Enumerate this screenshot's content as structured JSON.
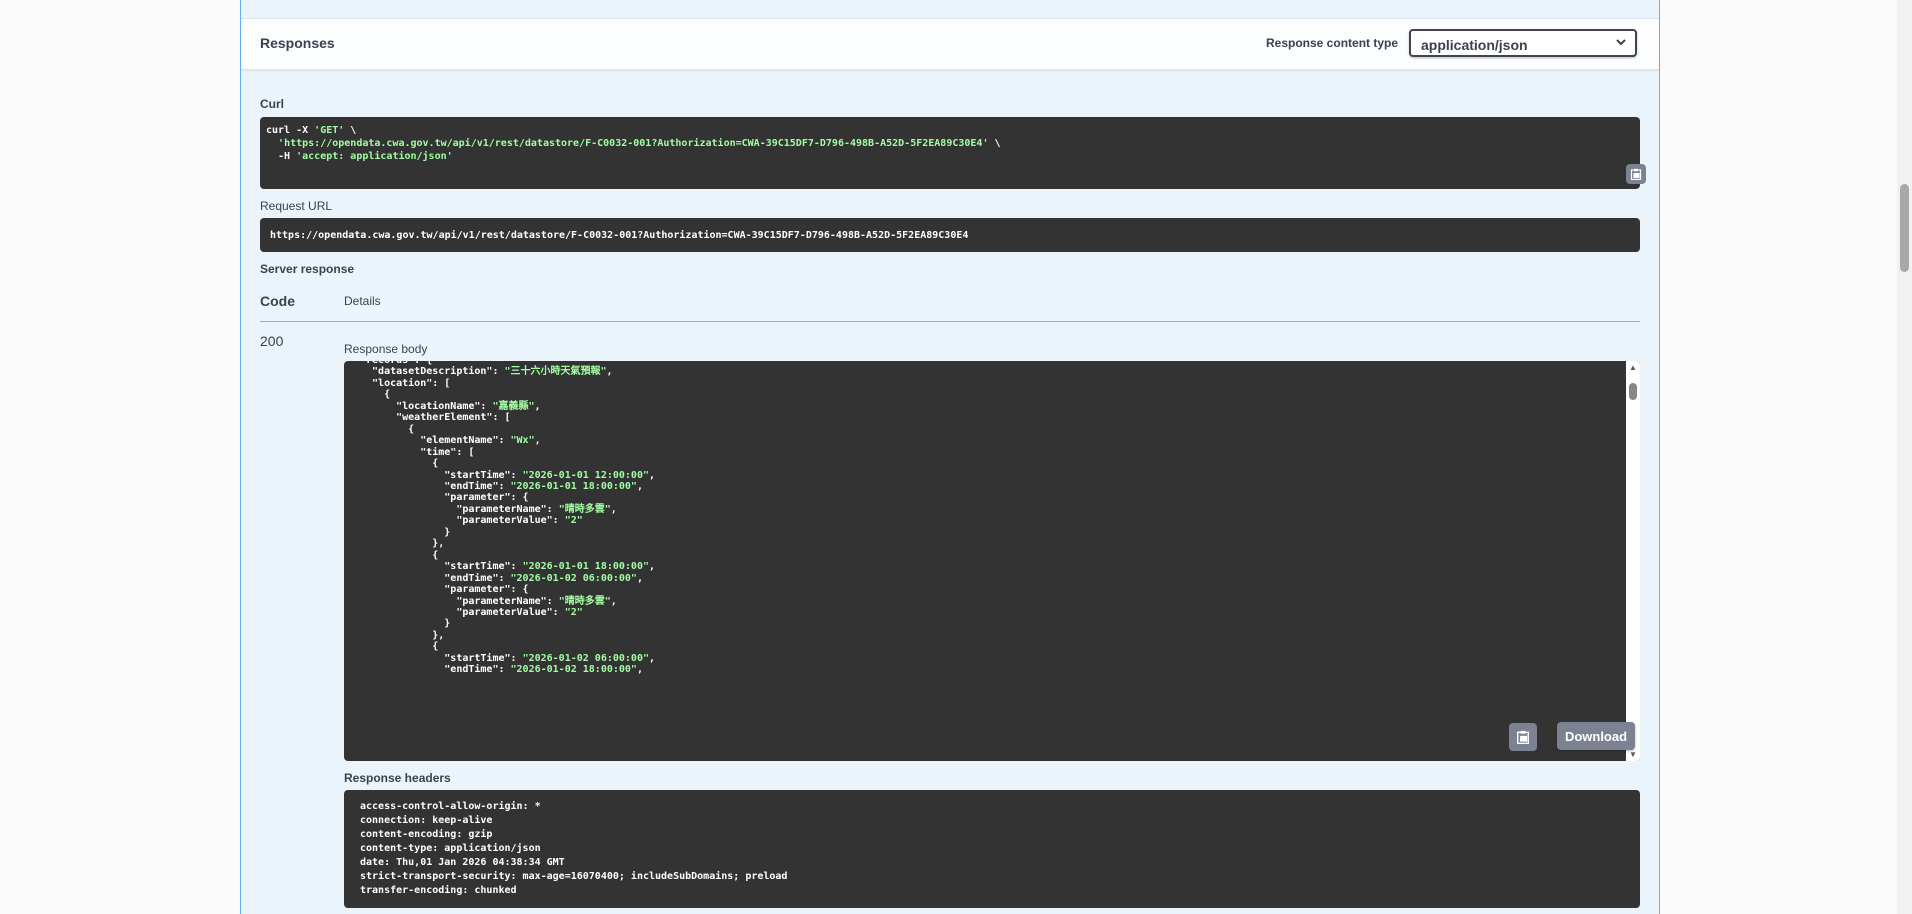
{
  "responses": {
    "title": "Responses",
    "content_type_label": "Response content type",
    "content_type_value": "application/json"
  },
  "curl": {
    "label": "Curl",
    "cmd": "curl -X ",
    "method": "'GET'",
    "backslash": " \\",
    "url_indent": "  ",
    "url": "'https://opendata.cwa.gov.tw/api/v1/rest/datastore/F-C0032-001?Authorization=CWA-39C15DF7-D796-498B-A52D-5F2EA89C30E4'",
    "header_flag": "  -H ",
    "header": "'accept: application/json'"
  },
  "request_url": {
    "label": "Request URL",
    "value": "https://opendata.cwa.gov.tw/api/v1/rest/datastore/F-C0032-001?Authorization=CWA-39C15DF7-D796-498B-A52D-5F2EA89C30E4"
  },
  "server_response": {
    "label": "Server response",
    "col_code": "Code",
    "col_details": "Details",
    "code": "200",
    "body_label": "Response body",
    "download_label": "Download",
    "headers_label": "Response headers"
  },
  "response_body_lines": [
    "\"records\": {",
    "  \"datasetDescription\": \"三十六小時天氣預報\",",
    "  \"location\": [",
    "    {",
    "      \"locationName\": \"嘉義縣\",",
    "      \"weatherElement\": [",
    "        {",
    "          \"elementName\": \"Wx\",",
    "          \"time\": [",
    "            {",
    "              \"startTime\": \"2026-01-01 12:00:00\",",
    "              \"endTime\": \"2026-01-01 18:00:00\",",
    "              \"parameter\": {",
    "                \"parameterName\": \"晴時多雲\",",
    "                \"parameterValue\": \"2\"",
    "              }",
    "            },",
    "            {",
    "              \"startTime\": \"2026-01-01 18:00:00\",",
    "              \"endTime\": \"2026-01-02 06:00:00\",",
    "              \"parameter\": {",
    "                \"parameterName\": \"晴時多雲\",",
    "                \"parameterValue\": \"2\"",
    "              }",
    "            },",
    "            {",
    "              \"startTime\": \"2026-01-02 06:00:00\",",
    "              \"endTime\": \"2026-01-02 18:00:00\","
  ],
  "response_headers": [
    "access-control-allow-origin: *",
    "connection: keep-alive",
    "content-encoding: gzip",
    "content-type: application/json",
    "date: Thu,01 Jan 2026 04:38:34 GMT",
    "strict-transport-security: max-age=16070400; includeSubDomains; preload",
    "transfer-encoding: chunked"
  ]
}
